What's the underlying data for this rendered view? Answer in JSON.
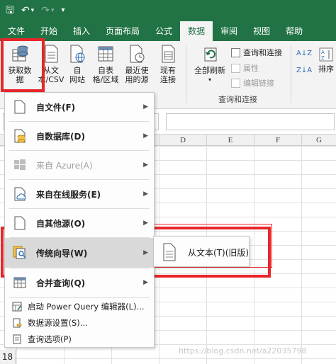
{
  "qat": {
    "save": "🖫",
    "undo": "↶",
    "undo_arrow": "▾",
    "redo": "↷",
    "redo_arrow": "▾",
    "customize": "▾"
  },
  "tabs": [
    "文件",
    "开始",
    "插入",
    "页面布局",
    "公式",
    "数据",
    "审阅",
    "视图",
    "帮助"
  ],
  "ribbon": {
    "get_data": "获取数\n据",
    "get_data_arrow": "▾",
    "from_csv": "从文\n本/CSV",
    "from_web": "自\n网站",
    "from_table": "自表\n格/区域",
    "recent_sources": "最近使\n用的源",
    "existing_connections": "现有\n连接",
    "refresh_all": "全部刷新",
    "refresh_arrow": "▾",
    "queries_connections": "查询和连接",
    "properties": "属性",
    "edit_links": "编辑链接",
    "group_label_queries": "查询和连接",
    "sort_az": "A↓Z",
    "sort_za": "Z↓A",
    "sort": "排序"
  },
  "columns": [
    "D",
    "E",
    "F",
    "G"
  ],
  "rows": [
    "18"
  ],
  "menu": {
    "items": [
      {
        "label": "自文件(F)",
        "arrow": "▶"
      },
      {
        "label": "自数据库(D)",
        "arrow": "▶"
      },
      {
        "label": "来自 Azure(A)",
        "arrow": "▶"
      },
      {
        "label": "来自在线服务(E)",
        "arrow": "▶"
      },
      {
        "label": "自其他源(O)",
        "arrow": "▶"
      },
      {
        "label": "传统向导(W)",
        "arrow": "▶"
      },
      {
        "label": "合并查询(Q)",
        "arrow": "▶"
      }
    ],
    "small_items": [
      {
        "label": "启动 Power Query 编辑器(L)..."
      },
      {
        "label": "数据源设置(S)..."
      },
      {
        "label": "查询选项(P)"
      }
    ]
  },
  "submenu": {
    "item": "从文本(T)(旧版)"
  },
  "watermark": "https://blog.csdn.net/a22035798",
  "colors": {
    "excel_green": "#217346",
    "highlight_red": "#e8262a"
  }
}
